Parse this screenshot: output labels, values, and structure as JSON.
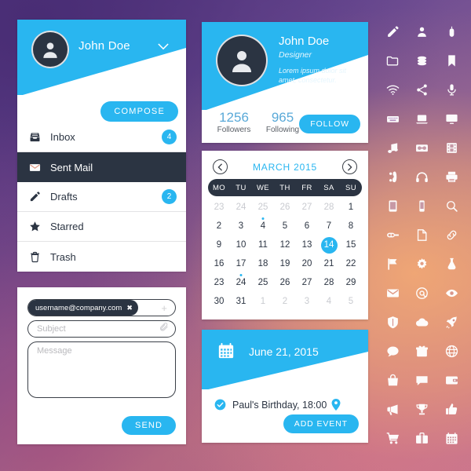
{
  "theme": {
    "accent": "#29b6f0",
    "dark": "#2b3442",
    "card_bg": "#ffffff",
    "muted_text": "#c9cbd0"
  },
  "mail_panel": {
    "user_name": "John Doe",
    "chevron_icon": "chevron-down-icon",
    "compose_label": "COMPOSE",
    "items": [
      {
        "label": "Inbox",
        "icon": "inbox-icon",
        "badge": "4",
        "active": false
      },
      {
        "label": "Sent Mail",
        "icon": "envelope-icon",
        "badge": "",
        "active": true
      },
      {
        "label": "Drafts",
        "icon": "pencil-icon",
        "badge": "2",
        "active": false
      },
      {
        "label": "Starred",
        "icon": "star-icon",
        "badge": "",
        "active": false
      },
      {
        "label": "Trash",
        "icon": "trash-icon",
        "badge": "",
        "active": false
      }
    ]
  },
  "compose": {
    "recipient_chip": "username@company.com",
    "chip_remove_icon": "close-icon",
    "add_recipient_icon": "plus-icon",
    "subject_placeholder": "Subject",
    "attach_icon": "paperclip-icon",
    "message_placeholder": "Message",
    "send_label": "SEND"
  },
  "profile": {
    "name": "John Doe",
    "role": "Designer",
    "bio": "Lorem ipsum dolor sit amet, consectetur.",
    "followers_count": "1256",
    "followers_label": "Followers",
    "following_count": "965",
    "following_label": "Following",
    "follow_label": "FOLLOW"
  },
  "calendar": {
    "title": "MARCH 2015",
    "prev_icon": "chevron-left-icon",
    "next_icon": "chevron-right-icon",
    "day_names": [
      "MO",
      "TU",
      "WE",
      "TH",
      "FR",
      "SA",
      "SU"
    ],
    "today": 14,
    "event_days": [
      4,
      24
    ],
    "weeks": [
      [
        {
          "d": "23",
          "muted": true
        },
        {
          "d": "24",
          "muted": true
        },
        {
          "d": "25",
          "muted": true
        },
        {
          "d": "26",
          "muted": true
        },
        {
          "d": "27",
          "muted": true
        },
        {
          "d": "28",
          "muted": true
        },
        {
          "d": "1",
          "muted": false
        }
      ],
      [
        {
          "d": "2",
          "muted": false
        },
        {
          "d": "3",
          "muted": false
        },
        {
          "d": "4",
          "muted": false,
          "dot": true
        },
        {
          "d": "5",
          "muted": false
        },
        {
          "d": "6",
          "muted": false
        },
        {
          "d": "7",
          "muted": false
        },
        {
          "d": "8",
          "muted": false
        }
      ],
      [
        {
          "d": "9",
          "muted": false
        },
        {
          "d": "10",
          "muted": false
        },
        {
          "d": "11",
          "muted": false
        },
        {
          "d": "12",
          "muted": false
        },
        {
          "d": "13",
          "muted": false
        },
        {
          "d": "14",
          "muted": false,
          "today": true
        },
        {
          "d": "15",
          "muted": false
        }
      ],
      [
        {
          "d": "16",
          "muted": false
        },
        {
          "d": "17",
          "muted": false
        },
        {
          "d": "18",
          "muted": false
        },
        {
          "d": "19",
          "muted": false
        },
        {
          "d": "20",
          "muted": false
        },
        {
          "d": "21",
          "muted": false
        },
        {
          "d": "22",
          "muted": false
        }
      ],
      [
        {
          "d": "23",
          "muted": false
        },
        {
          "d": "24",
          "muted": false,
          "dot": true
        },
        {
          "d": "25",
          "muted": false
        },
        {
          "d": "26",
          "muted": false
        },
        {
          "d": "27",
          "muted": false
        },
        {
          "d": "28",
          "muted": false
        },
        {
          "d": "29",
          "muted": false
        }
      ],
      [
        {
          "d": "30",
          "muted": false
        },
        {
          "d": "31",
          "muted": false
        },
        {
          "d": "1",
          "muted": true
        },
        {
          "d": "2",
          "muted": true
        },
        {
          "d": "3",
          "muted": true
        },
        {
          "d": "4",
          "muted": true
        },
        {
          "d": "5",
          "muted": true
        }
      ]
    ]
  },
  "event": {
    "date": "June 21, 2015",
    "date_icon": "calendar-icon",
    "check_icon": "check-circle-icon",
    "title": "Paul's Birthday, 18:00",
    "location_icon": "map-pin-icon",
    "add_label": "ADD EVENT"
  },
  "icon_grid": {
    "icons": [
      "pencil-icon",
      "user-icon",
      "mouse-icon",
      "folder-icon",
      "layers-icon",
      "bookmark-icon",
      "wifi-icon",
      "share-icon",
      "microphone-icon",
      "keyboard-icon",
      "laptop-icon",
      "monitor-icon",
      "music-note-icon",
      "camera-icon",
      "film-icon",
      "phone-icon",
      "headphones-icon",
      "printer-icon",
      "tablet-icon",
      "smartphone-icon",
      "search-icon",
      "key-icon",
      "document-icon",
      "link-icon",
      "flag-icon",
      "gear-icon",
      "flask-icon",
      "envelope-icon",
      "at-sign-icon",
      "eye-icon",
      "shield-icon",
      "cloud-icon",
      "rocket-icon",
      "chat-icon",
      "box-icon",
      "globe-icon",
      "bag-icon",
      "speech-bubble-icon",
      "wallet-icon",
      "megaphone-icon",
      "trophy-icon",
      "thumbs-up-icon",
      "cart-icon",
      "briefcase-icon",
      "calendar-grid-icon"
    ]
  }
}
